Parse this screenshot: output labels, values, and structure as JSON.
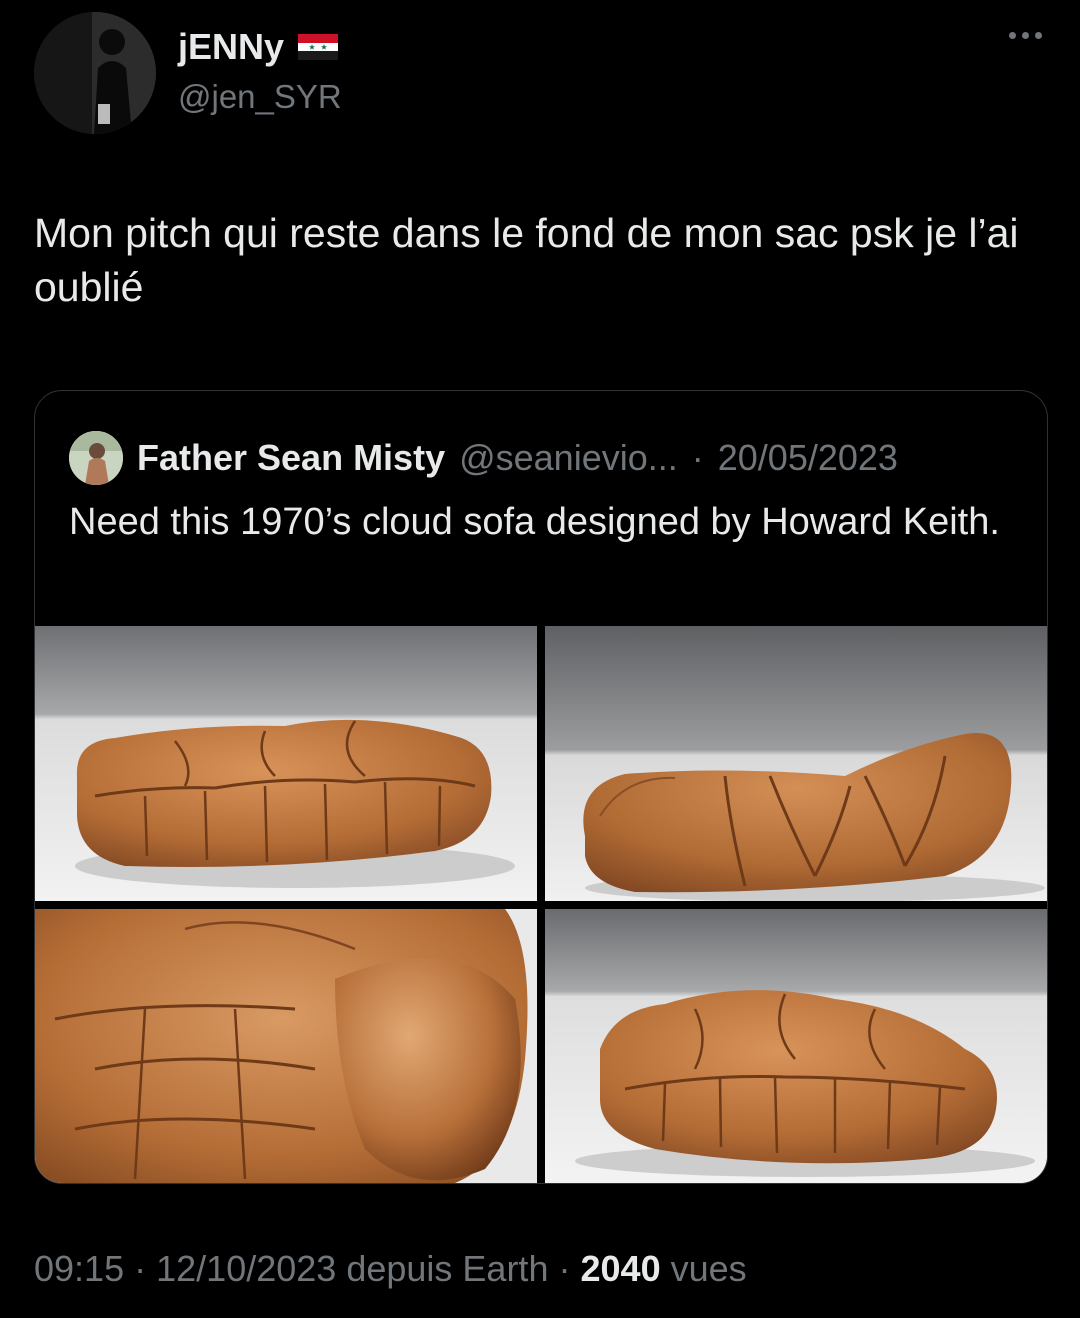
{
  "author": {
    "name": "jENNy",
    "handle": "@jen_SYR",
    "flag_icon": "syria-flag-icon"
  },
  "tweet": {
    "text": "Mon pitch qui reste dans le fond de mon sac psk je l’ai oublié"
  },
  "quoted": {
    "name": "Father Sean Misty",
    "handle": "@seanievio...",
    "separator": "·",
    "date": "20/05/2023",
    "text": "Need this 1970’s cloud sofa designed by Howard Keith.",
    "media": [
      {
        "alt": "tan leather cloud sofa, three-quarter view"
      },
      {
        "alt": "tan leather cloud sofa, side view"
      },
      {
        "alt": "close-up of tufted leather cushions"
      },
      {
        "alt": "tan leather cloud sofa, angled view"
      }
    ]
  },
  "meta": {
    "time": "09:15",
    "sep1": "·",
    "date": "12/10/2023",
    "source": "depuis Earth",
    "sep2": "·",
    "views": "2040",
    "views_label": "vues"
  },
  "colors": {
    "background": "#000000",
    "text": "#e7e9ea",
    "muted": "#71767b",
    "border": "#2f3336",
    "leather": "#b56d36"
  }
}
